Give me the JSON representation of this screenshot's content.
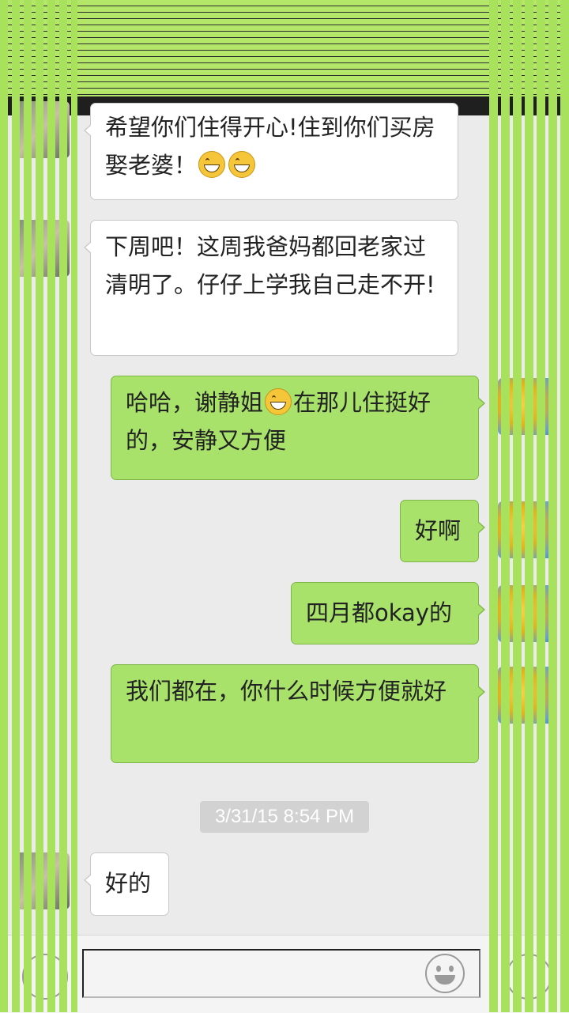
{
  "header": {
    "title": ""
  },
  "messages": [
    {
      "side": "in",
      "text_parts": [
        "希望你们住得开心!住到你们买房娶老婆！",
        "",
        ""
      ],
      "emoji_count": 2
    },
    {
      "side": "in",
      "text": "下周吧！这周我爸妈都回老家过清明了。仔仔上学我自己走不开!"
    },
    {
      "side": "out",
      "text_before": "哈哈，谢静姐",
      "text_after": "在那儿住挺好的，安静又方便"
    },
    {
      "side": "out",
      "text": "好啊"
    },
    {
      "side": "out",
      "text": "四月都okay的"
    },
    {
      "side": "out",
      "text": "我们都在，你什么时候方便就好"
    },
    {
      "side": "in",
      "text": "好的"
    }
  ],
  "timestamp": "3/31/15 8:54 PM",
  "input": {
    "value": "",
    "placeholder": ""
  },
  "icons": {
    "voice": "voice-icon",
    "emoji": "emoji-icon",
    "plus": "plus-icon",
    "grin": "grin-emoji-icon"
  },
  "colors": {
    "outgoing_bubble": "#a8e26a",
    "incoming_bubble": "#ffffff",
    "background": "#ebebeb",
    "glitch_green": "#a8e25c"
  }
}
